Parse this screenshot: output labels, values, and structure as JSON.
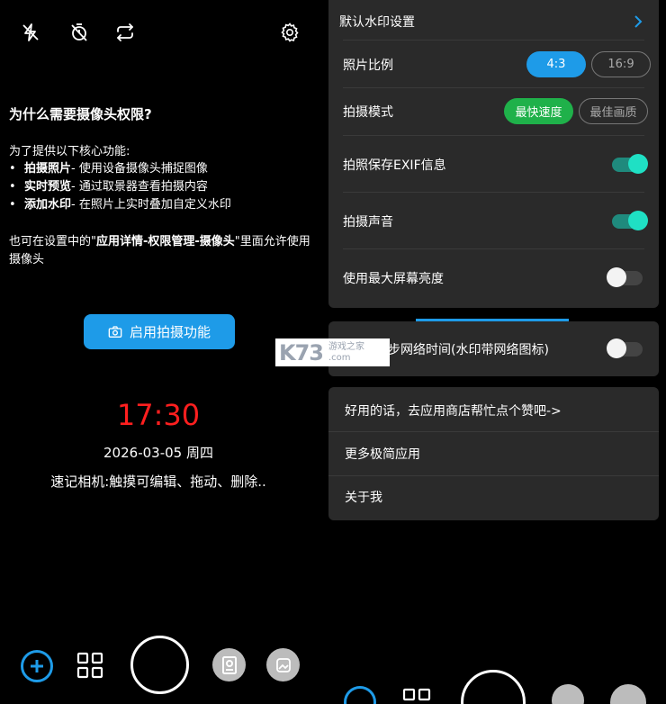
{
  "left": {
    "permission": {
      "title": "为什么需要摄像头权限?",
      "intro": "为了提供以下核心功能:",
      "items": [
        {
          "bold": "拍摄照片",
          "text": " - 使用设备摄像头捕捉图像"
        },
        {
          "bold": "实时预览",
          "text": " - 通过取景器查看拍摄内容"
        },
        {
          "bold": "添加水印",
          "text": " - 在照片上实时叠加自定义水印"
        }
      ],
      "note_prefix": "也可在设置中的\"",
      "note_bold": "应用详情-权限管理-摄像头",
      "note_suffix": "\"里面允许使用摄像头"
    },
    "enable_button": "启用拍摄功能",
    "clock": "17:30",
    "date": "2026-03-05 周四",
    "hint": "速记相机:触摸可编辑、拖动、删除.."
  },
  "settings": {
    "default_watermark": "默认水印设置",
    "photo_ratio": {
      "label": "照片比例",
      "options": [
        "4:3",
        "16:9"
      ],
      "selected": "4:3"
    },
    "shoot_mode": {
      "label": "拍摄模式",
      "options": [
        "最快速度",
        "最佳画质"
      ],
      "selected": "最快速度"
    },
    "exif": {
      "label": "拍照保存EXIF信息",
      "on": true
    },
    "sound": {
      "label": "拍摄声音",
      "on": true
    },
    "max_brightness": {
      "label": "使用最大屏幕亮度",
      "on": false
    },
    "network_time": {
      "label": "步网络时间(水印带网络图标)",
      "on": false
    }
  },
  "links": {
    "rate": "好用的话，去应用商店帮忙点个赞吧->",
    "more_apps": "更多极简应用",
    "about": "关于我"
  },
  "watermark": {
    "logo": "K73",
    "line1": "游戏之家",
    "line2": ".com"
  },
  "colors": {
    "accent": "#1e9be8",
    "green": "#1fb14a",
    "teal": "#1fe0c4",
    "clock": "#ff1f1f"
  }
}
